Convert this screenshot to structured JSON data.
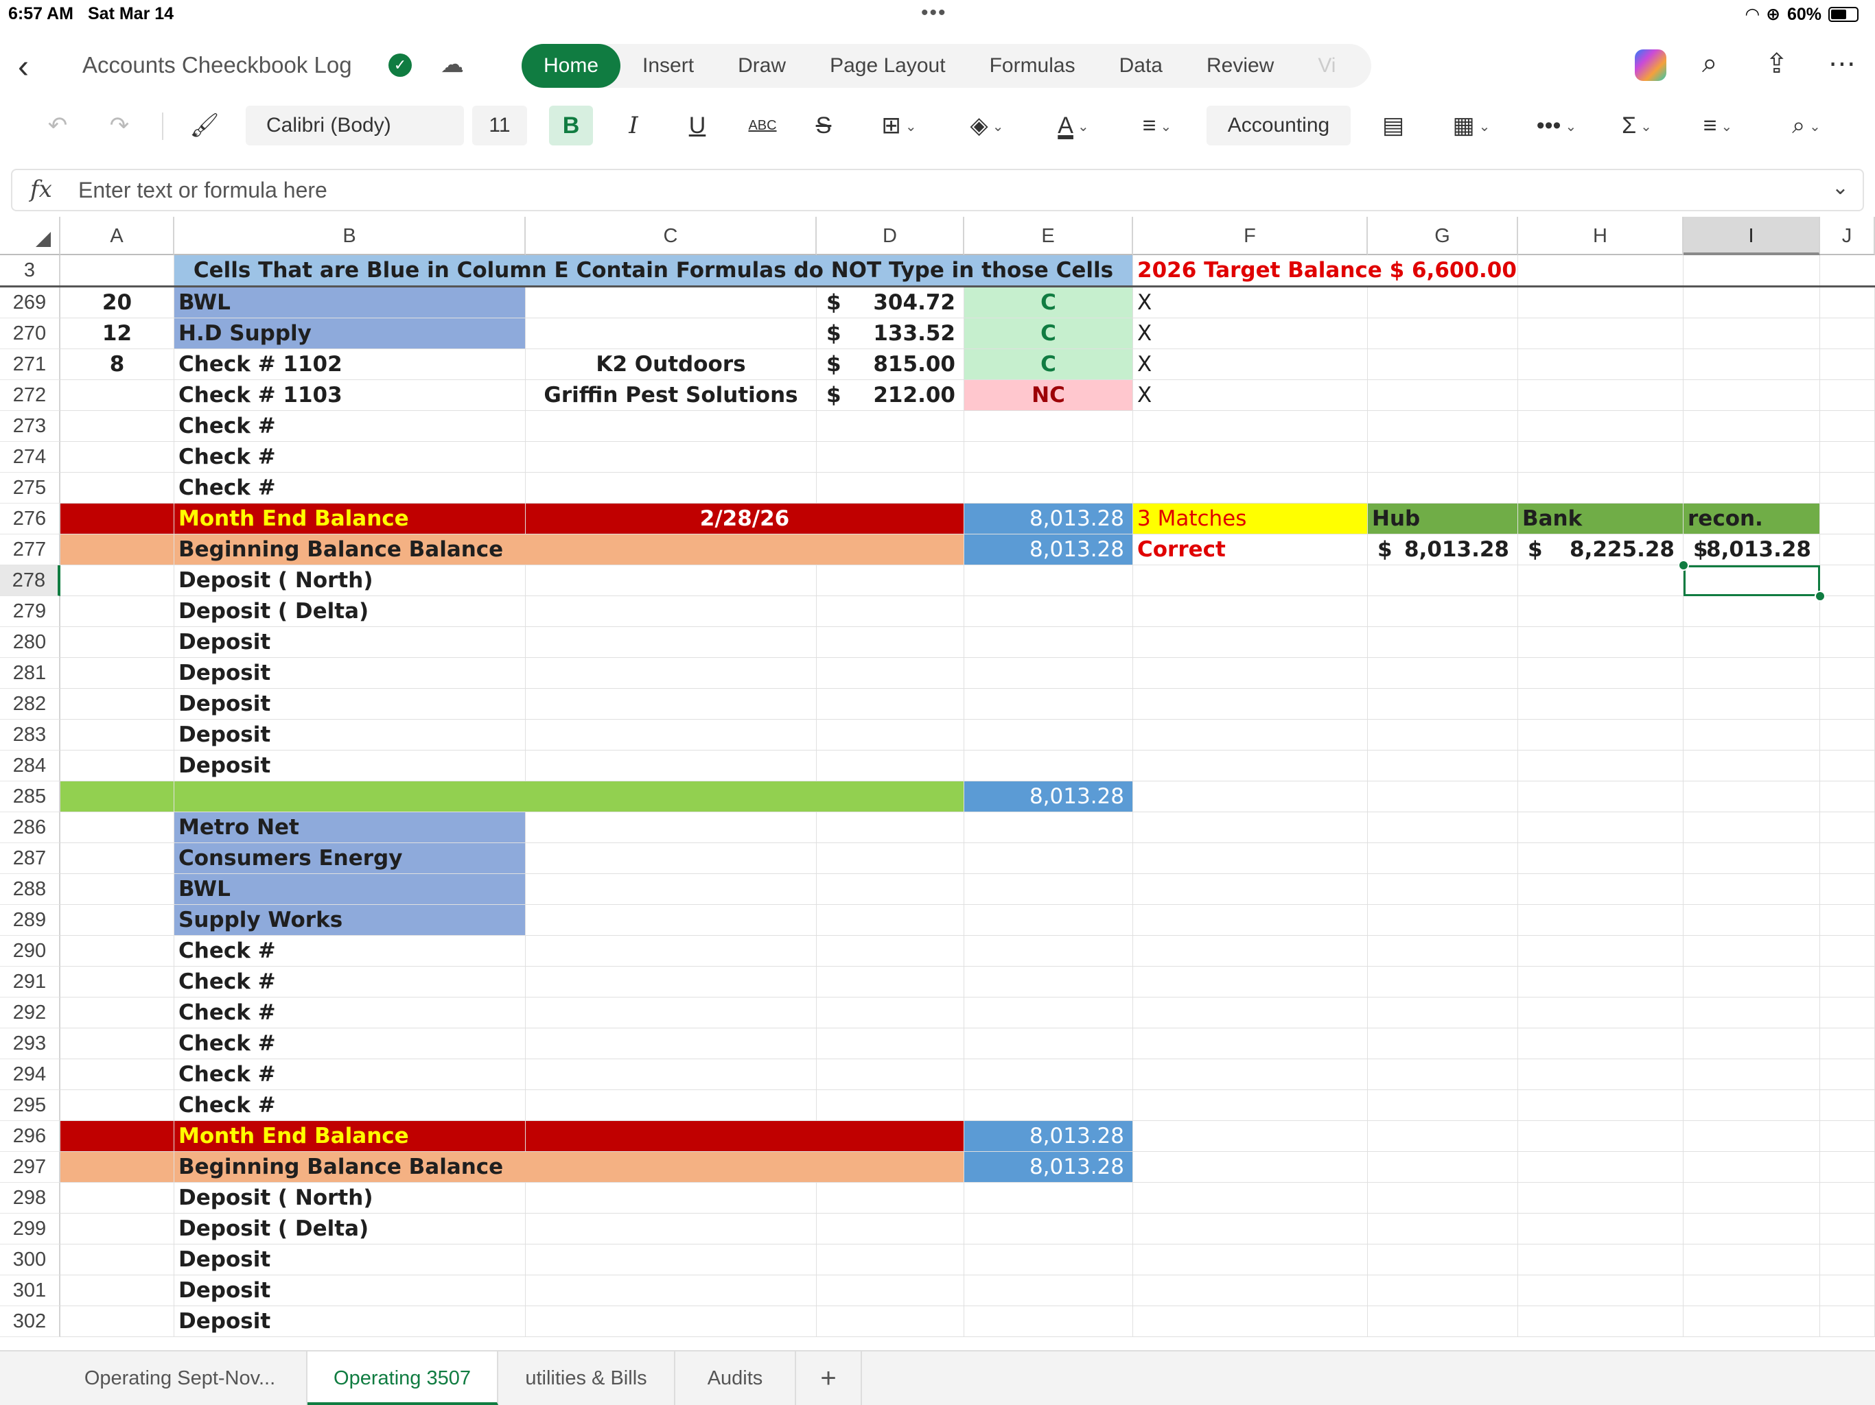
{
  "status_bar": {
    "time": "6:57 AM",
    "date": "Sat Mar 14",
    "battery": "60%",
    "battery_level": 0.6
  },
  "header": {
    "doc_title": "Accounts Cheeckbook Log",
    "tabs": [
      "Home",
      "Insert",
      "Draw",
      "Page Layout",
      "Formulas",
      "Data",
      "Review",
      "Vi"
    ],
    "active_tab": "Home"
  },
  "toolbar": {
    "font_name": "Calibri (Body)",
    "font_size": "11",
    "bold_label": "B",
    "italic_label": "I",
    "underline_label": "U",
    "spell_label": "ABC",
    "number_format": "Accounting"
  },
  "formula_bar": {
    "fx": "fx",
    "placeholder": "Enter text or formula here"
  },
  "grid": {
    "columns": [
      "A",
      "B",
      "C",
      "D",
      "E",
      "F",
      "G",
      "H",
      "I",
      "J"
    ],
    "selected_column": "I",
    "selected_row": "278",
    "header_row": {
      "num": "3",
      "banner": "Cells That are Blue in Column E Contain Formulas do NOT Type in those Cells",
      "target": "2026 Target Balance $ 6,600.00"
    },
    "rows": [
      {
        "num": "269",
        "A": "20",
        "B": "BWL",
        "D_sym": "$",
        "D": "304.72",
        "E": "C",
        "F": "X"
      },
      {
        "num": "270",
        "A": "12",
        "B": "H.D Supply",
        "D_sym": "$",
        "D": "133.52",
        "E": "C",
        "F": "X"
      },
      {
        "num": "271",
        "A": "8",
        "B": "Check # 1102",
        "C": "K2 Outdoors",
        "D_sym": "$",
        "D": "815.00",
        "E": "C",
        "F": "X"
      },
      {
        "num": "272",
        "B": "Check #  1103",
        "C": "Griffin Pest Solutions",
        "D_sym": "$",
        "D": "212.00",
        "E": "NC",
        "F": "X"
      },
      {
        "num": "273",
        "B": "Check #"
      },
      {
        "num": "274",
        "B": "Check #"
      },
      {
        "num": "275",
        "B": "Check #"
      },
      {
        "num": "276",
        "B": "Month End Balance",
        "C": "2/28/26",
        "E": "8,013.28",
        "F": "3 Matches",
        "G": "Hub",
        "H": "Bank",
        "I": "recon."
      },
      {
        "num": "277",
        "B": "Beginning  Balance Balance",
        "E": "8,013.28",
        "F": "Correct",
        "G_sym": "$",
        "G": "8,013.28",
        "H_sym": "$",
        "H": "8,225.28",
        "I_sym": "$",
        "I": "8,013.28"
      },
      {
        "num": "278",
        "B": "Deposit ( North)"
      },
      {
        "num": "279",
        "B": "Deposit ( Delta)"
      },
      {
        "num": "280",
        "B": "Deposit"
      },
      {
        "num": "281",
        "B": "Deposit"
      },
      {
        "num": "282",
        "B": "Deposit"
      },
      {
        "num": "283",
        "B": "Deposit"
      },
      {
        "num": "284",
        "B": "Deposit"
      },
      {
        "num": "285",
        "E": "8,013.28"
      },
      {
        "num": "286",
        "B": "Metro Net"
      },
      {
        "num": "287",
        "B": "Consumers Energy"
      },
      {
        "num": "288",
        "B": "BWL"
      },
      {
        "num": "289",
        "B": "Supply Works"
      },
      {
        "num": "290",
        "B": "Check #"
      },
      {
        "num": "291",
        "B": "Check #"
      },
      {
        "num": "292",
        "B": "Check #"
      },
      {
        "num": "293",
        "B": "Check #"
      },
      {
        "num": "294",
        "B": "Check #"
      },
      {
        "num": "295",
        "B": "Check #"
      },
      {
        "num": "296",
        "B": "Month End Balance",
        "E": "8,013.28"
      },
      {
        "num": "297",
        "B": "Beginning  Balance Balance",
        "E": "8,013.28"
      },
      {
        "num": "298",
        "B": "Deposit ( North)"
      },
      {
        "num": "299",
        "B": "Deposit ( Delta)"
      },
      {
        "num": "300",
        "B": "Deposit"
      },
      {
        "num": "301",
        "B": "Deposit"
      },
      {
        "num": "302",
        "B": "Deposit"
      }
    ]
  },
  "sheet_tabs": [
    "Operating  Sept-Nov...",
    "Operating 3507",
    "utilities & Bills",
    "Audits"
  ],
  "active_sheet": "Operating 3507",
  "add_sheet": "+",
  "colors": {
    "accent": "#107c41",
    "formula_blue": "#5b9bd5",
    "month_end_red": "#c00000"
  }
}
